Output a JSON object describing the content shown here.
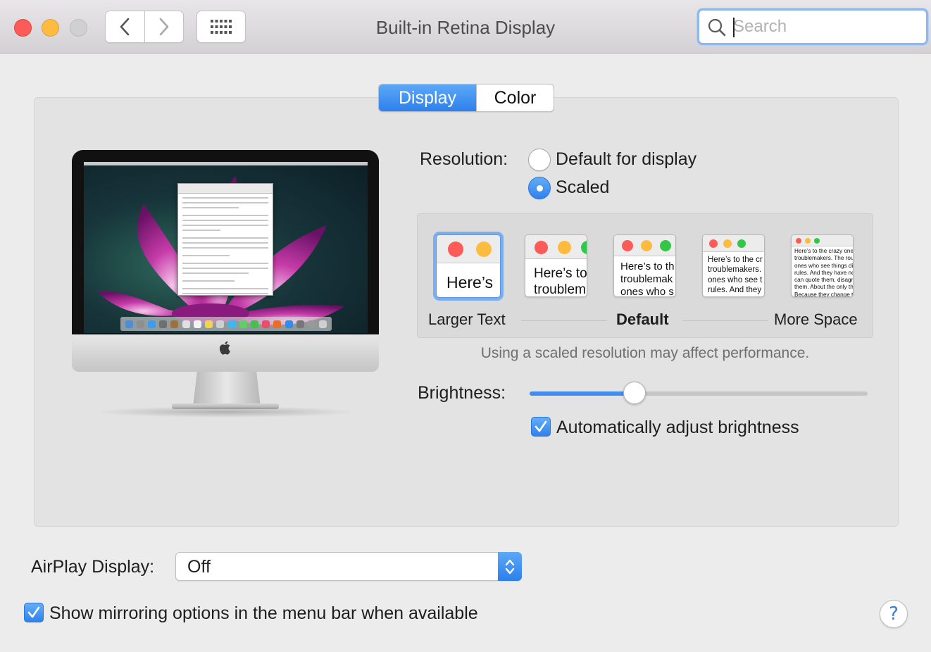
{
  "window": {
    "title": "Built-in Retina Display",
    "search_placeholder": "Search"
  },
  "tabs": [
    {
      "label": "Display",
      "selected": true
    },
    {
      "label": "Color",
      "selected": false
    }
  ],
  "resolution": {
    "label": "Resolution:",
    "options": [
      {
        "label": "Default for display",
        "selected": false
      },
      {
        "label": "Scaled",
        "selected": true
      }
    ],
    "scale_labels": {
      "left": "Larger Text",
      "middle": "Default",
      "right": "More Space"
    },
    "thumbnails": [
      {
        "text": "Here’s",
        "selected": true
      },
      {
        "text": "Here’s to\ntroublem",
        "selected": false
      },
      {
        "text": "Here’s to th\ntroublemak\nones who s",
        "selected": false
      },
      {
        "text": "Here’s to the cr\ntroublemakers.\nones who see t\nrules. And they",
        "selected": false
      },
      {
        "text": "Here’s to the crazy one\ntroublemakers. The rou\nones who see things di\nrules. And they have no\ncan quote them, disagr\nthem. About the only th\nBecause they change th",
        "selected": false
      }
    ],
    "hint": "Using a scaled resolution may affect performance."
  },
  "brightness": {
    "label": "Brightness:",
    "value": 0.31,
    "auto_label": "Automatically adjust brightness",
    "auto_checked": true
  },
  "airplay": {
    "label": "AirPlay Display:",
    "value": "Off"
  },
  "mirroring": {
    "label": "Show mirroring options in the menu bar when available",
    "checked": true
  },
  "colors": {
    "accent": "#3f8df0",
    "close": "#fc5b57",
    "minimize": "#fdbc40",
    "zoom_disabled": "#d0d0d0"
  },
  "icons": {
    "back": "chevron-left-icon",
    "forward": "chevron-right-icon",
    "grid": "grid-icon",
    "search": "search-icon",
    "apple": "apple-logo-icon",
    "help": "question-mark-icon"
  }
}
